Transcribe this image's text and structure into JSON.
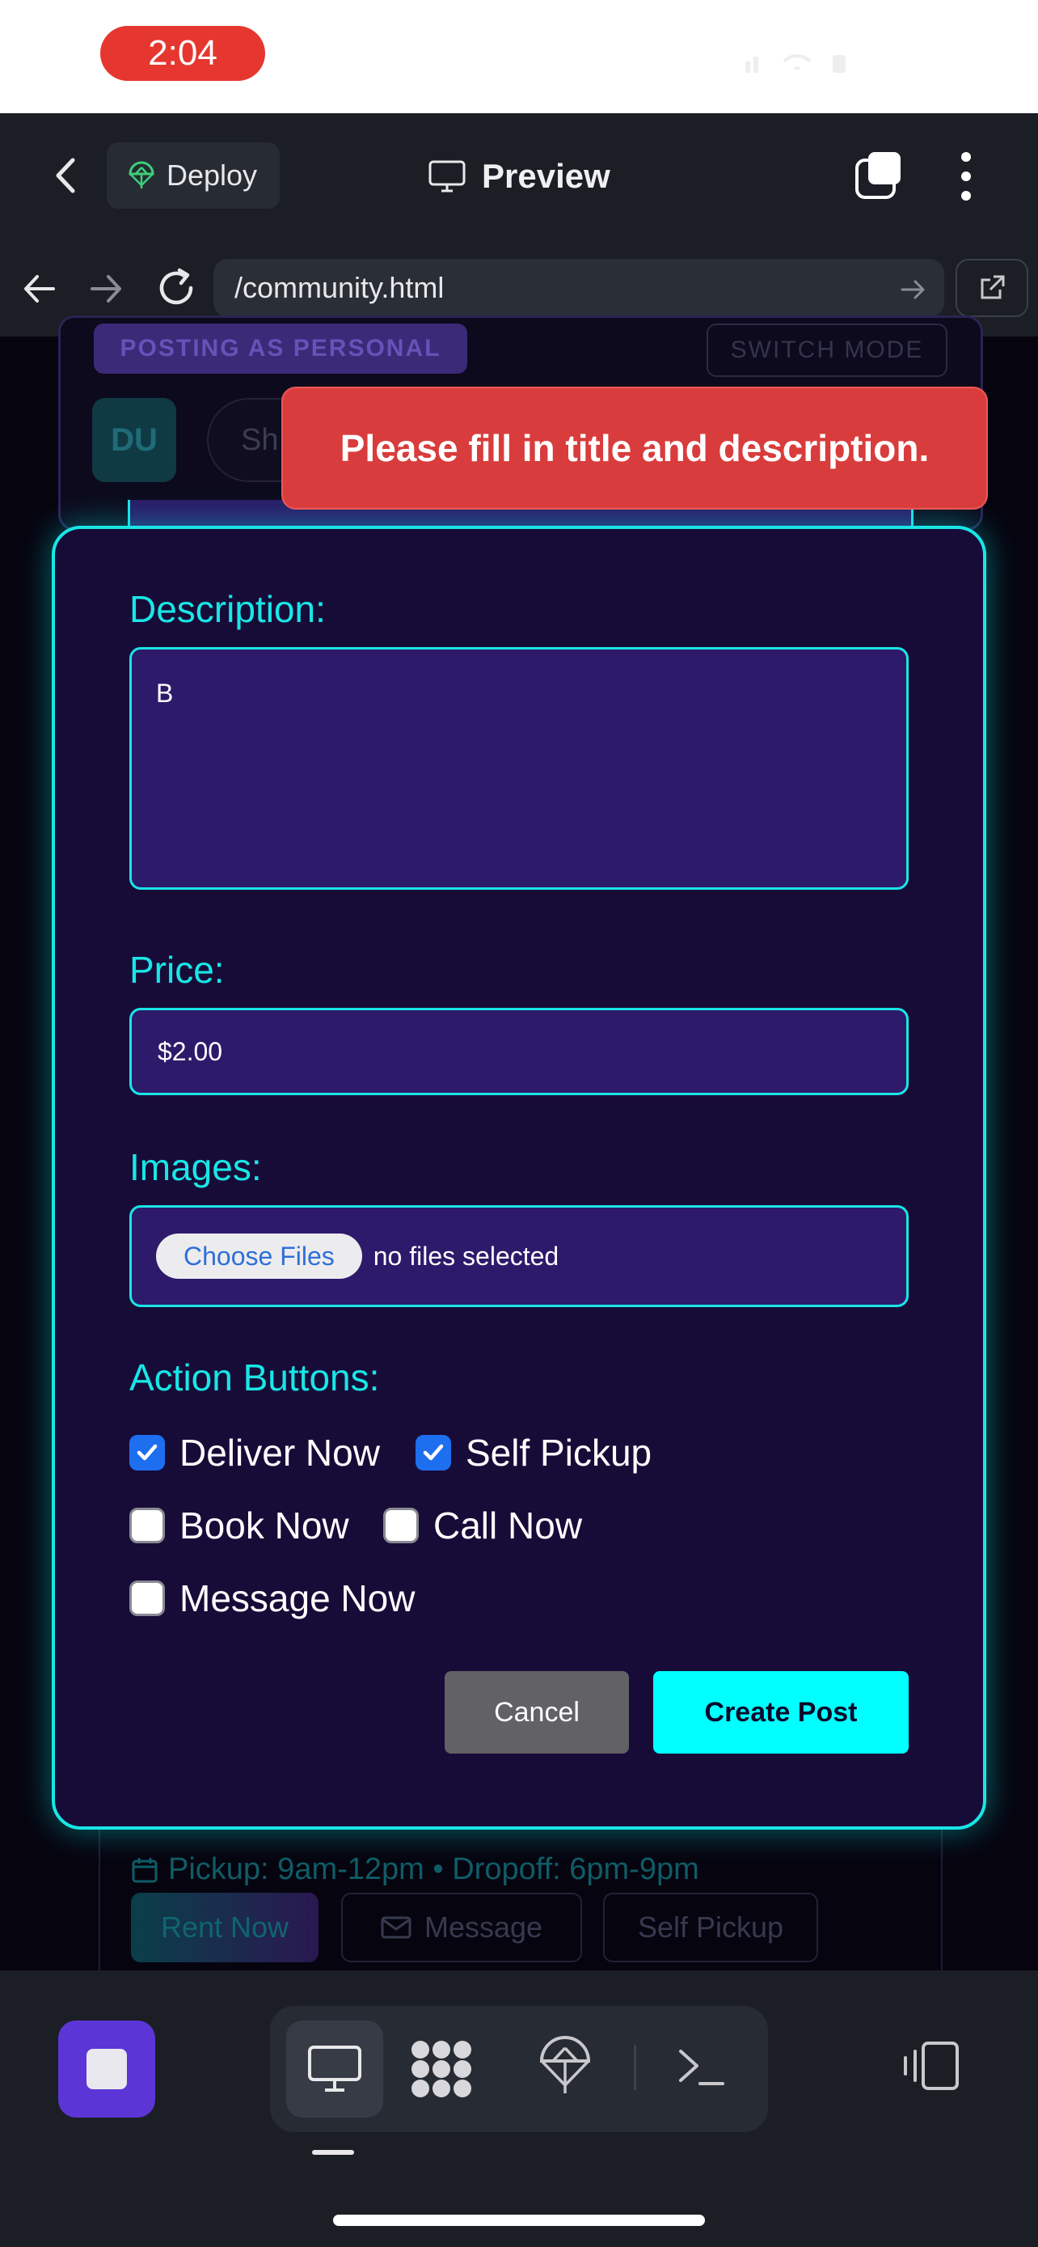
{
  "status": {
    "time": "2:04"
  },
  "header": {
    "deploy_label": "Deploy",
    "preview_label": "Preview"
  },
  "browser": {
    "url": "/community.html"
  },
  "background_page": {
    "posting_badge": "POSTING AS PERSONAL",
    "switch_mode": "SWITCH MODE",
    "avatar_initials": "DU",
    "share_placeholder": "Sh",
    "pickup_info": "Pickup: 9am-12pm • Dropoff: 6pm-9pm",
    "rent_now": "Rent Now",
    "message": "Message",
    "self_pickup": "Self Pickup"
  },
  "toast": {
    "message": "Please fill in title and description."
  },
  "form": {
    "description_label": "Description:",
    "description_value": "B",
    "price_label": "Price:",
    "price_value": "$2.00",
    "images_label": "Images:",
    "choose_files": "Choose Files",
    "no_files": "no files selected",
    "actions_label": "Action Buttons:",
    "options": [
      {
        "label": "Deliver Now",
        "checked": true
      },
      {
        "label": "Self Pickup",
        "checked": true
      },
      {
        "label": "Book Now",
        "checked": false
      },
      {
        "label": "Call Now",
        "checked": false
      },
      {
        "label": "Message Now",
        "checked": false
      }
    ],
    "cancel": "Cancel",
    "create": "Create Post"
  },
  "colors": {
    "accent": "#19e6e6",
    "toast": "#d93c3c",
    "modal_bg": "#170c38",
    "stop_button": "#5b35d5"
  }
}
